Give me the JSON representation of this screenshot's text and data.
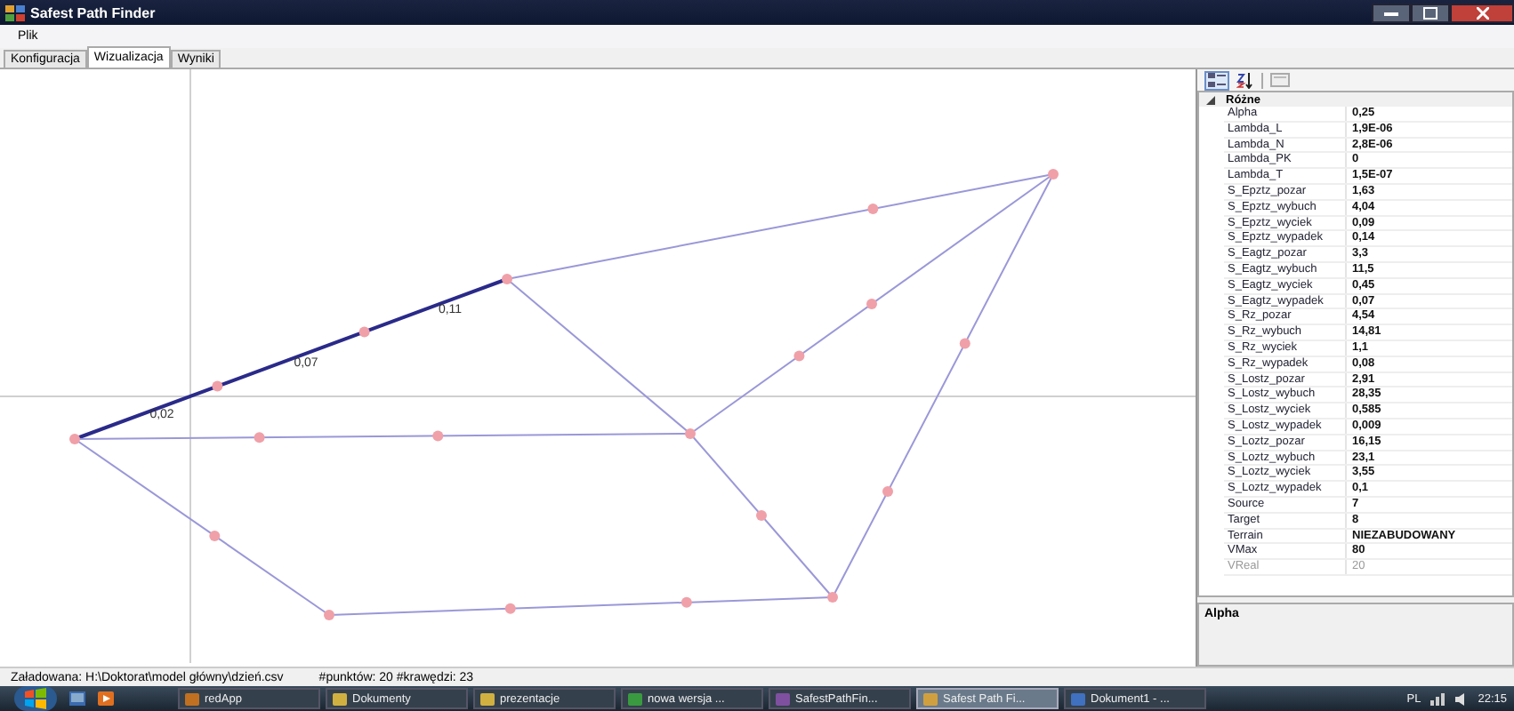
{
  "window": {
    "title": "Safest Path Finder"
  },
  "menu": [
    "Plik"
  ],
  "tabs": [
    {
      "label": "Konfiguracja",
      "selected": false
    },
    {
      "label": "Wizualizacja",
      "selected": true
    },
    {
      "label": "Wyniki",
      "selected": false
    }
  ],
  "graph": {
    "edges": [
      {
        "highlighted": true,
        "label": "0,02"
      },
      {
        "highlighted": true,
        "label": "0,07"
      },
      {
        "highlighted": true,
        "label": "0,11"
      },
      {
        "highlighted": false
      },
      {
        "highlighted": false
      },
      {
        "highlighted": false
      },
      {
        "highlighted": false
      },
      {
        "highlighted": false
      },
      {
        "highlighted": false
      },
      {
        "highlighted": false
      },
      {
        "highlighted": false
      }
    ]
  },
  "property_grid": {
    "category": "Różne",
    "rows": [
      {
        "name": "Alpha",
        "value": "0,25",
        "disabled": false
      },
      {
        "name": "Lambda_L",
        "value": "1,9E-06",
        "disabled": false
      },
      {
        "name": "Lambda_N",
        "value": "2,8E-06",
        "disabled": false
      },
      {
        "name": "Lambda_PK",
        "value": "0",
        "disabled": false
      },
      {
        "name": "Lambda_T",
        "value": "1,5E-07",
        "disabled": false
      },
      {
        "name": "S_Epztz_pozar",
        "value": "1,63",
        "disabled": false
      },
      {
        "name": "S_Epztz_wybuch",
        "value": "4,04",
        "disabled": false
      },
      {
        "name": "S_Epztz_wyciek",
        "value": "0,09",
        "disabled": false
      },
      {
        "name": "S_Epztz_wypadek",
        "value": "0,14",
        "disabled": false
      },
      {
        "name": "S_Eagtz_pozar",
        "value": "3,3",
        "disabled": false
      },
      {
        "name": "S_Eagtz_wybuch",
        "value": "11,5",
        "disabled": false
      },
      {
        "name": "S_Eagtz_wyciek",
        "value": "0,45",
        "disabled": false
      },
      {
        "name": "S_Eagtz_wypadek",
        "value": "0,07",
        "disabled": false
      },
      {
        "name": "S_Rz_pozar",
        "value": "4,54",
        "disabled": false
      },
      {
        "name": "S_Rz_wybuch",
        "value": "14,81",
        "disabled": false
      },
      {
        "name": "S_Rz_wyciek",
        "value": "1,1",
        "disabled": false
      },
      {
        "name": "S_Rz_wypadek",
        "value": "0,08",
        "disabled": false
      },
      {
        "name": "S_Lostz_pozar",
        "value": "2,91",
        "disabled": false
      },
      {
        "name": "S_Lostz_wybuch",
        "value": "28,35",
        "disabled": false
      },
      {
        "name": "S_Lostz_wyciek",
        "value": "0,585",
        "disabled": false
      },
      {
        "name": "S_Lostz_wypadek",
        "value": "0,009",
        "disabled": false
      },
      {
        "name": "S_Loztz_pozar",
        "value": "16,15",
        "disabled": false
      },
      {
        "name": "S_Loztz_wybuch",
        "value": "23,1",
        "disabled": false
      },
      {
        "name": "S_Loztz_wyciek",
        "value": "3,55",
        "disabled": false
      },
      {
        "name": "S_Loztz_wypadek",
        "value": "0,1",
        "disabled": false
      },
      {
        "name": "Source",
        "value": "7",
        "disabled": false
      },
      {
        "name": "Target",
        "value": "8",
        "disabled": false
      },
      {
        "name": "Terrain",
        "value": "NIEZABUDOWANY",
        "disabled": false
      },
      {
        "name": "VMax",
        "value": "80",
        "disabled": false
      },
      {
        "name": "VReal",
        "value": "20",
        "disabled": true
      }
    ],
    "description_title": "Alpha"
  },
  "status_bar": [
    "Załadowana: H:\\Doktorat\\model główny\\dzień.csv",
    "#punktów: 20 #krawędzi: 23"
  ],
  "taskbar": {
    "items": [
      {
        "label": "redApp",
        "selected": false
      },
      {
        "label": "Dokumenty",
        "selected": false
      },
      {
        "label": "prezentacje",
        "selected": false
      },
      {
        "label": "nowa wersja ...",
        "selected": false
      },
      {
        "label": "SafestPathFin...",
        "selected": false
      },
      {
        "label": "Safest Path Fi...",
        "selected": true
      },
      {
        "label": "Dokument1 - ...",
        "selected": false
      }
    ],
    "language": "PL",
    "clock": "22:15"
  }
}
